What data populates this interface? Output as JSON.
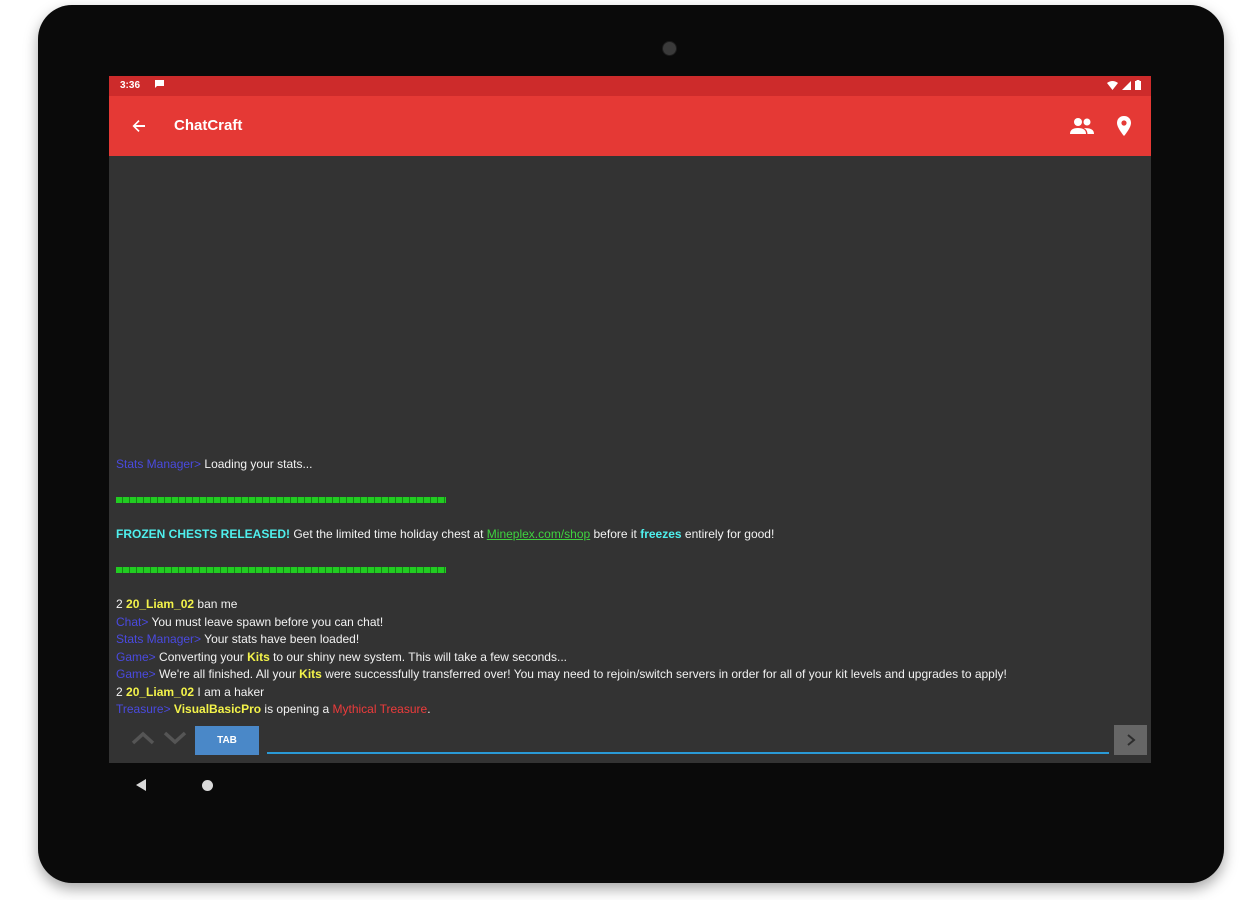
{
  "status_bar": {
    "time": "3:36",
    "icons": [
      "message-icon",
      "wifi-icon",
      "signal-icon",
      "battery-icon"
    ]
  },
  "app_bar": {
    "title": "ChatCraft",
    "actions": [
      "people-icon",
      "location-icon"
    ]
  },
  "colors": {
    "app_bar": "#e53935",
    "status_bar": "#cd2b2b",
    "chat_bg": "#333333",
    "tab_button": "#4a88c8",
    "input_underline": "#2a9ad6"
  },
  "chat": {
    "lines": [
      {
        "segments": [
          {
            "text": "Stats Manager> ",
            "color": "blue"
          },
          {
            "text": "Loading your stats...",
            "color": "white"
          }
        ]
      },
      {
        "type": "blank"
      },
      {
        "type": "bar"
      },
      {
        "type": "blank"
      },
      {
        "segments": [
          {
            "text": "FROZEN CHESTS RELEASED!",
            "color": "aqua"
          },
          {
            "text": " Get the limited time holiday chest at ",
            "color": "white"
          },
          {
            "text": "Mineplex.com/shop",
            "color": "green"
          },
          {
            "text": " before it ",
            "color": "white"
          },
          {
            "text": "freezes",
            "color": "aqua"
          },
          {
            "text": " entirely for good!",
            "color": "white"
          }
        ]
      },
      {
        "type": "blank"
      },
      {
        "type": "bar"
      },
      {
        "type": "blank"
      },
      {
        "segments": [
          {
            "text": "2 ",
            "color": "white"
          },
          {
            "text": "20_Liam_02",
            "color": "yellow"
          },
          {
            "text": " ban me",
            "color": "white"
          }
        ]
      },
      {
        "segments": [
          {
            "text": "Chat> ",
            "color": "blue"
          },
          {
            "text": "You must leave spawn before you can chat!",
            "color": "white"
          }
        ]
      },
      {
        "segments": [
          {
            "text": "Stats Manager> ",
            "color": "blue"
          },
          {
            "text": "Your stats have been loaded!",
            "color": "white"
          }
        ]
      },
      {
        "segments": [
          {
            "text": "Game> ",
            "color": "blue"
          },
          {
            "text": "Converting your ",
            "color": "white"
          },
          {
            "text": "Kits",
            "color": "yellow"
          },
          {
            "text": " to our shiny new system. This will take a few seconds...",
            "color": "white"
          }
        ]
      },
      {
        "segments": [
          {
            "text": "Game> ",
            "color": "blue"
          },
          {
            "text": "We're all finished. All your ",
            "color": "white"
          },
          {
            "text": "Kits",
            "color": "yellow"
          },
          {
            "text": " were successfully transferred over! You may need to rejoin/switch servers in order for all of your kit levels and upgrades to apply!",
            "color": "white"
          }
        ]
      },
      {
        "segments": [
          {
            "text": "2 ",
            "color": "white"
          },
          {
            "text": "20_Liam_02",
            "color": "yellow"
          },
          {
            "text": " I am a haker",
            "color": "white"
          }
        ]
      },
      {
        "segments": [
          {
            "text": "Treasure> ",
            "color": "blue"
          },
          {
            "text": "VisualBasicPro",
            "color": "yellow"
          },
          {
            "text": " is opening a ",
            "color": "white"
          },
          {
            "text": "Mythical Treasure",
            "color": "red"
          },
          {
            "text": ".",
            "color": "white"
          }
        ]
      }
    ]
  },
  "input_bar": {
    "tab_label": "TAB",
    "input_value": "",
    "input_placeholder": "",
    "icons": [
      "chevron-up-icon",
      "chevron-down-icon",
      "send-icon"
    ]
  },
  "nav_bar": {
    "icons": [
      "nav-back-icon",
      "nav-home-icon"
    ]
  }
}
